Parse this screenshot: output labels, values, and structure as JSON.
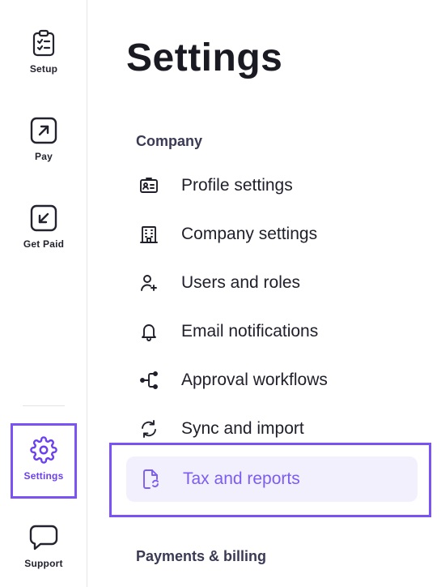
{
  "nav": {
    "setup": "Setup",
    "pay": "Pay",
    "get_paid": "Get Paid",
    "settings": "Settings",
    "support": "Support"
  },
  "page": {
    "title": "Settings"
  },
  "sections": {
    "company": "Company",
    "payments_billing": "Payments & billing"
  },
  "menu": {
    "profile_settings": "Profile settings",
    "company_settings": "Company settings",
    "users_roles": "Users and roles",
    "email_notifications": "Email notifications",
    "approval_workflows": "Approval workflows",
    "sync_import": "Sync and import",
    "tax_reports": "Tax and reports"
  },
  "colors": {
    "accent": "#7b52f5",
    "active_text": "#7c5cf2",
    "active_bg": "#f3f0fe"
  }
}
